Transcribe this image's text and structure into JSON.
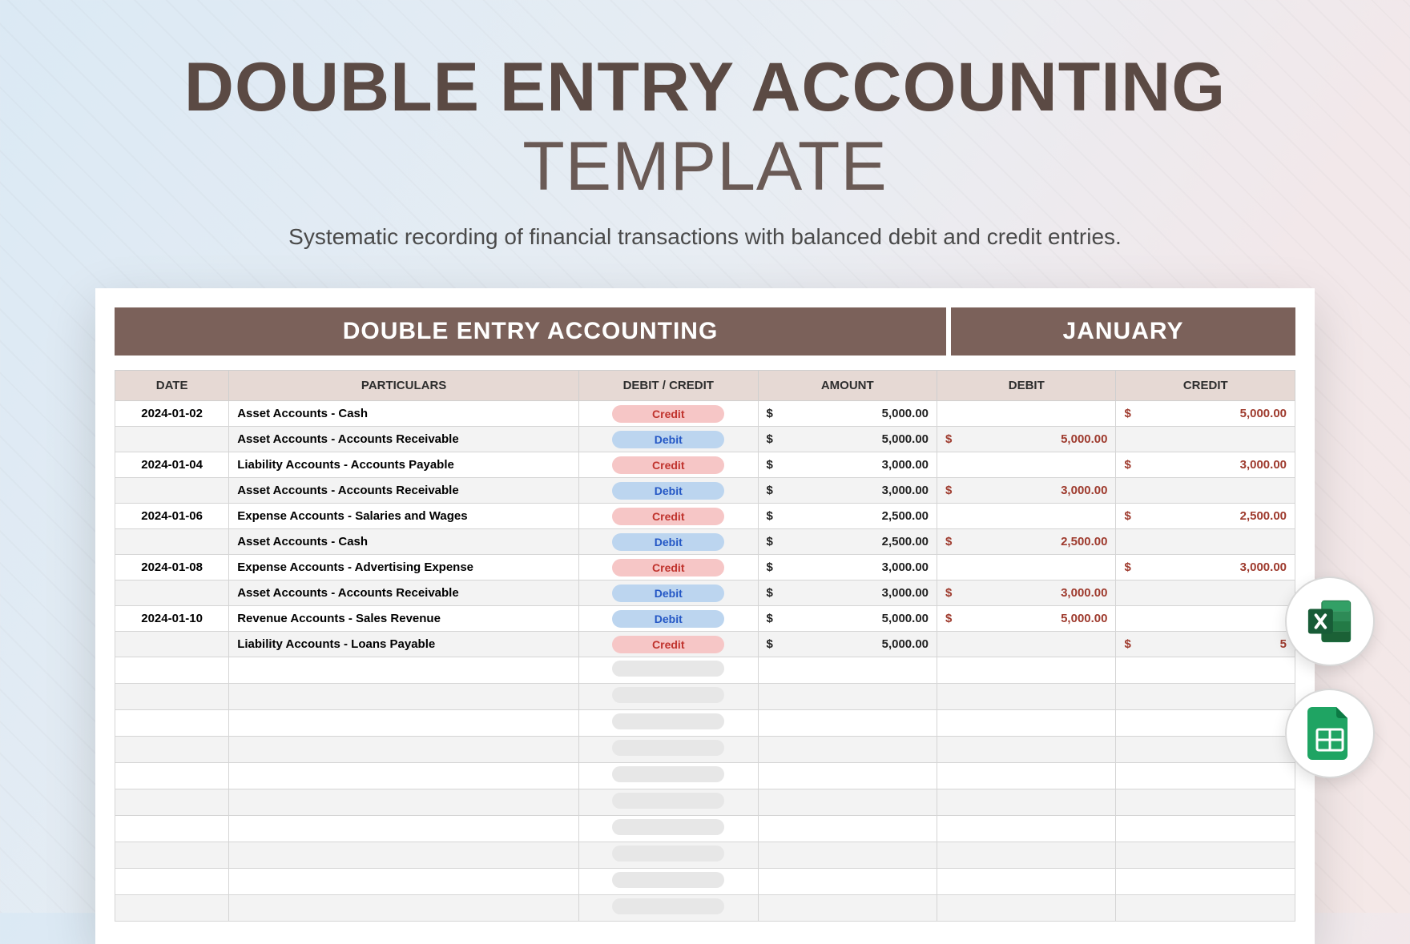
{
  "hero": {
    "bold": "DOUBLE ENTRY ACCOUNTING",
    "thin": "TEMPLATE"
  },
  "subtitle": "Systematic recording of financial transactions with balanced debit and credit entries.",
  "banner": {
    "title": "DOUBLE ENTRY ACCOUNTING",
    "month": "JANUARY"
  },
  "columns": [
    "DATE",
    "Particulars",
    "DEBIT / CREDIT",
    "AMOUNT",
    "DEBIT",
    "CREDIT"
  ],
  "currency": "$",
  "rows": [
    {
      "date": "2024-01-02",
      "particulars": "Asset Accounts - Cash",
      "dc": "Credit",
      "amount": "5,000.00",
      "debit": "",
      "credit": "5,000.00"
    },
    {
      "date": "",
      "particulars": "Asset Accounts - Accounts Receivable",
      "dc": "Debit",
      "amount": "5,000.00",
      "debit": "5,000.00",
      "credit": ""
    },
    {
      "date": "2024-01-04",
      "particulars": "Liability Accounts - Accounts Payable",
      "dc": "Credit",
      "amount": "3,000.00",
      "debit": "",
      "credit": "3,000.00"
    },
    {
      "date": "",
      "particulars": "Asset Accounts - Accounts Receivable",
      "dc": "Debit",
      "amount": "3,000.00",
      "debit": "3,000.00",
      "credit": ""
    },
    {
      "date": "2024-01-06",
      "particulars": "Expense Accounts - Salaries and Wages",
      "dc": "Credit",
      "amount": "2,500.00",
      "debit": "",
      "credit": "2,500.00"
    },
    {
      "date": "",
      "particulars": "Asset Accounts - Cash",
      "dc": "Debit",
      "amount": "2,500.00",
      "debit": "2,500.00",
      "credit": ""
    },
    {
      "date": "2024-01-08",
      "particulars": "Expense Accounts - Advertising Expense",
      "dc": "Credit",
      "amount": "3,000.00",
      "debit": "",
      "credit": "3,000.00"
    },
    {
      "date": "",
      "particulars": "Asset Accounts - Accounts Receivable",
      "dc": "Debit",
      "amount": "3,000.00",
      "debit": "3,000.00",
      "credit": ""
    },
    {
      "date": "2024-01-10",
      "particulars": "Revenue Accounts - Sales Revenue",
      "dc": "Debit",
      "amount": "5,000.00",
      "debit": "5,000.00",
      "credit": ""
    },
    {
      "date": "",
      "particulars": "Liability Accounts - Loans Payable",
      "dc": "Credit",
      "amount": "5,000.00",
      "debit": "",
      "credit": "5"
    }
  ],
  "empty_rows": 10,
  "badges": {
    "excel": "excel-icon",
    "sheets": "google-sheets-icon"
  }
}
